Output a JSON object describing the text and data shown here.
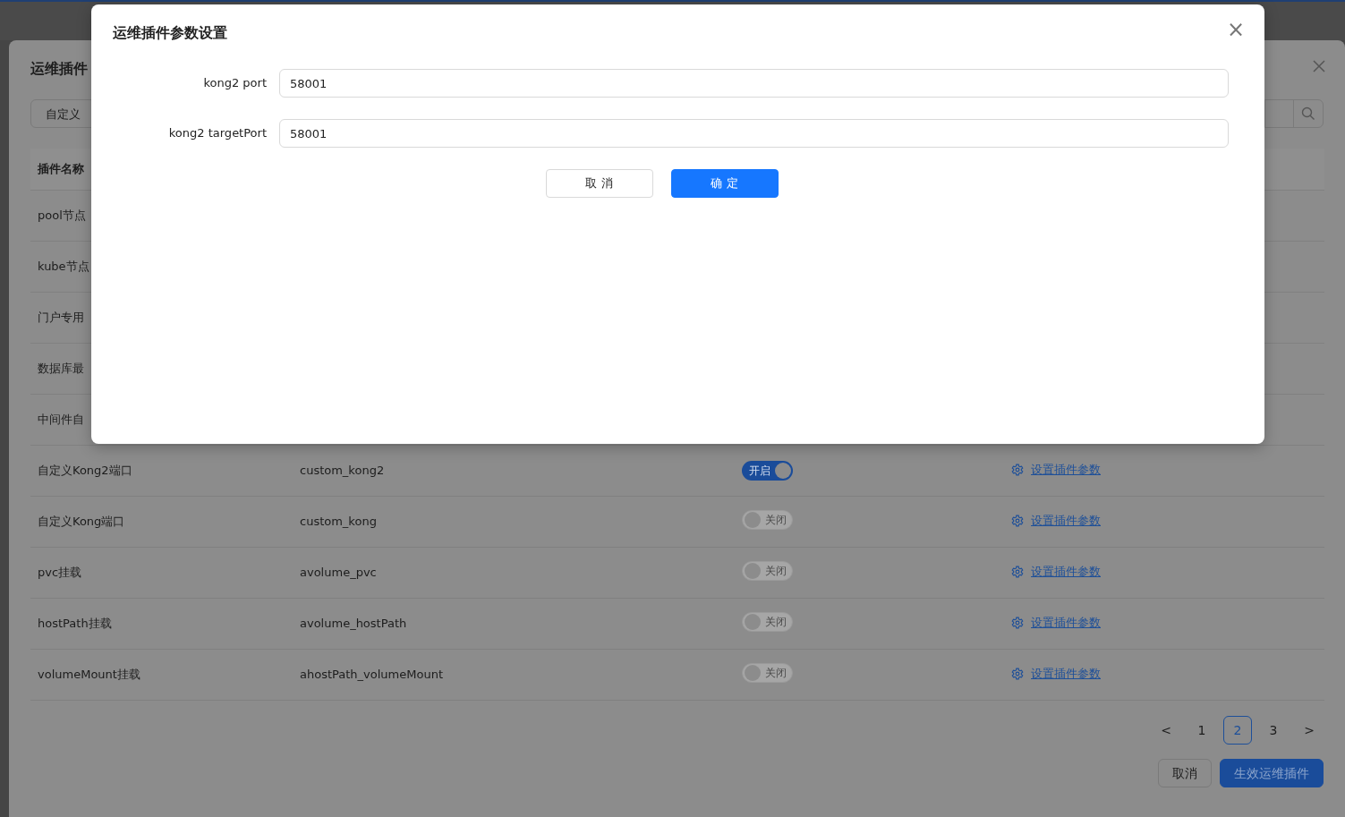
{
  "back_dialog": {
    "title": "运维插件",
    "select_value": "自定义",
    "table": {
      "columns": [
        "插件名称"
      ],
      "rows": [
        {
          "name": "pool节点"
        },
        {
          "name": "kube节点"
        },
        {
          "name": "门户专用"
        },
        {
          "name": "数据库最"
        },
        {
          "name": "中间件自"
        },
        {
          "name": "自定义Kong2端口",
          "code": "custom_kong2",
          "enabled": true,
          "switch_label": "开启",
          "action": "设置插件参数"
        },
        {
          "name": "自定义Kong端口",
          "code": "custom_kong",
          "enabled": false,
          "switch_label": "关闭",
          "action": "设置插件参数"
        },
        {
          "name": "pvc挂载",
          "code": "avolume_pvc",
          "enabled": false,
          "switch_label": "关闭",
          "action": "设置插件参数"
        },
        {
          "name": "hostPath挂载",
          "code": "avolume_hostPath",
          "enabled": false,
          "switch_label": "关闭",
          "action": "设置插件参数"
        },
        {
          "name": "volumeMount挂载",
          "code": "ahostPath_volumeMount",
          "enabled": false,
          "switch_label": "关闭",
          "action": "设置插件参数"
        }
      ]
    },
    "pagination": {
      "prev": "<",
      "next": ">",
      "pages": [
        {
          "label": "1",
          "selected": false
        },
        {
          "label": "2",
          "selected": true
        },
        {
          "label": "3",
          "selected": false
        }
      ]
    },
    "buttons": [
      {
        "label": "取消",
        "kind": "secondary"
      },
      {
        "label": "生效运维插件",
        "kind": "primary"
      }
    ]
  },
  "modal": {
    "title": "运维插件参数设置",
    "close": "×",
    "fields": [
      {
        "label": "kong2 port",
        "value": "58001"
      },
      {
        "label": "kong2 targetPort",
        "value": "58001"
      }
    ],
    "buttons": [
      {
        "label": "取 消",
        "kind": "secondary"
      },
      {
        "label": "确 定",
        "kind": "primary"
      }
    ]
  }
}
